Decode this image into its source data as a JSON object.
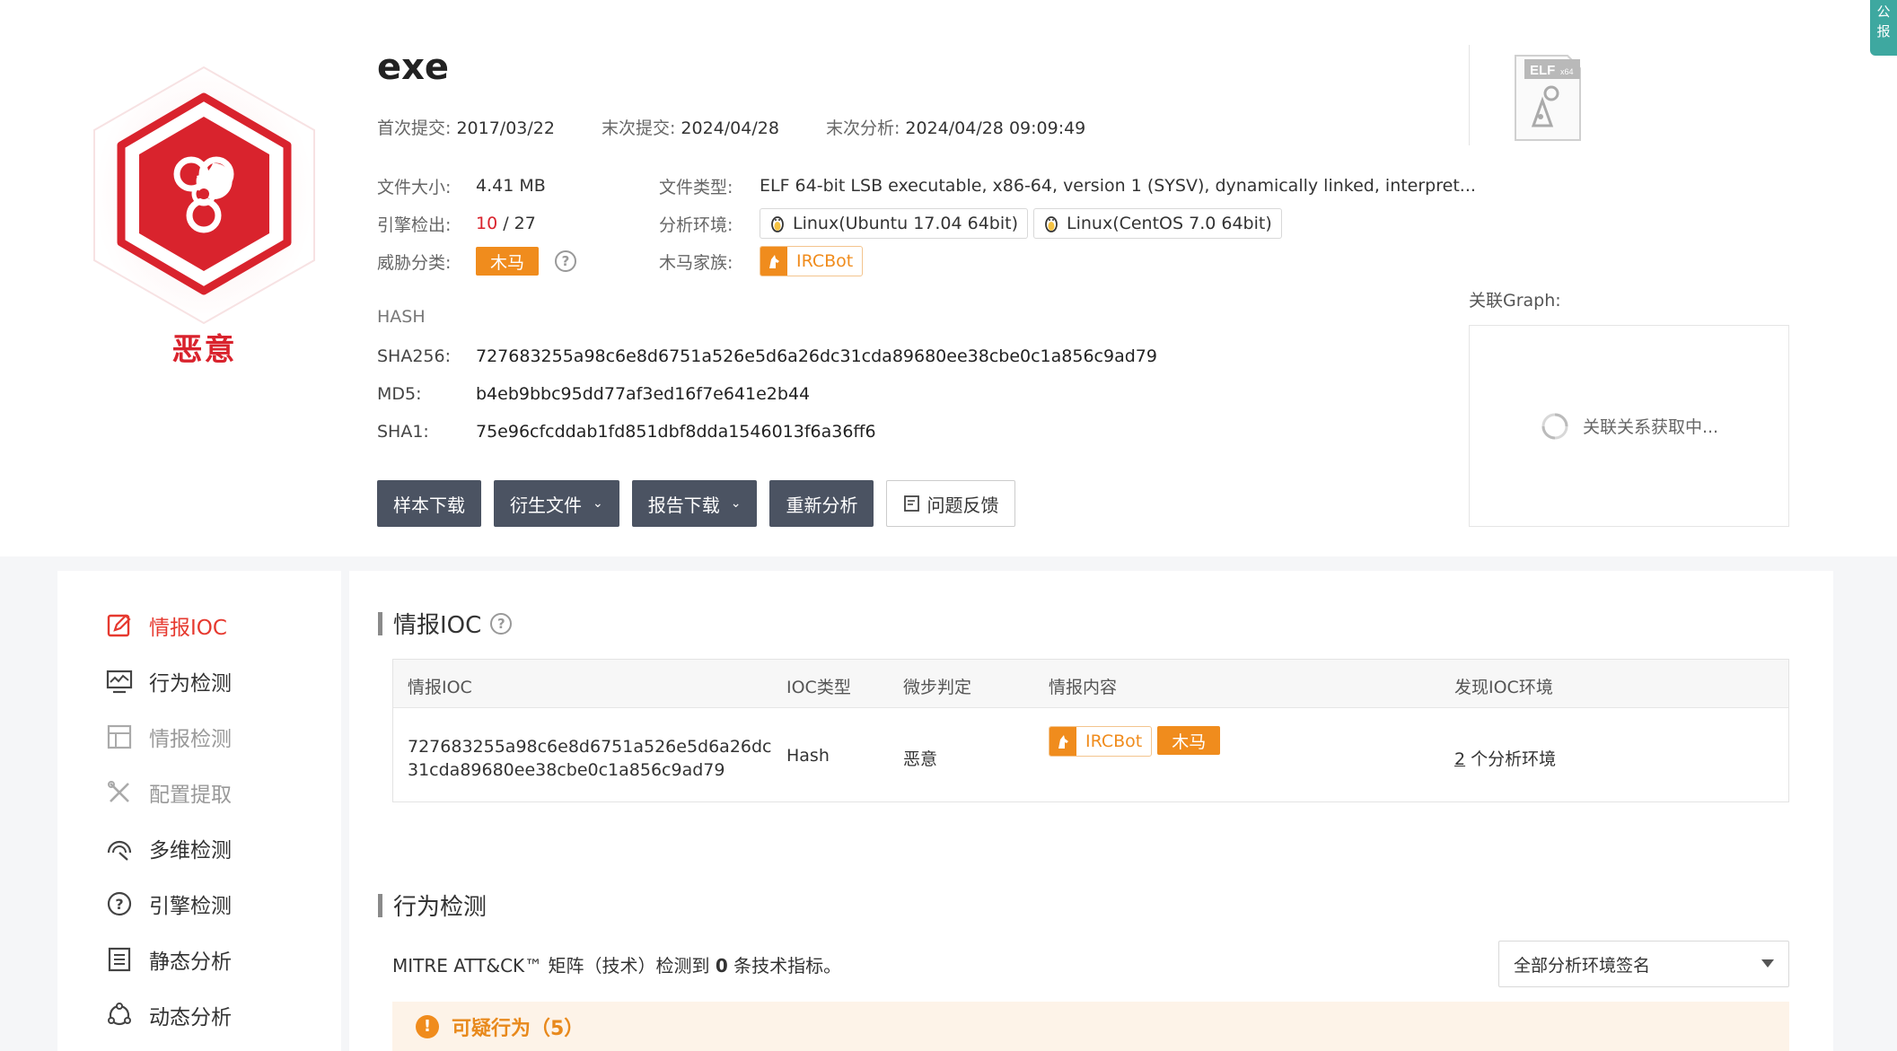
{
  "verdict": {
    "label": "恶意",
    "color": "#d9232d"
  },
  "file": {
    "name": "exe",
    "first_submit_label": "首次提交:",
    "first_submit": "2017/03/22",
    "last_submit_label": "末次提交:",
    "last_submit": "2024/04/28",
    "last_analysis_label": "末次分析:",
    "last_analysis": "2024/04/28 09:09:49",
    "size_label": "文件大小:",
    "size": "4.41 MB",
    "type_label": "文件类型:",
    "type": "ELF 64-bit LSB executable, x86-64, version 1 (SYSV), dynamically linked, interpret...",
    "engine_label": "引擎检出:",
    "engine_hits": "10",
    "engine_total": "/ 27",
    "env_label": "分析环境:",
    "envs": [
      "Linux(Ubuntu 17.04 64bit)",
      "Linux(CentOS 7.0 64bit)"
    ],
    "threat_label": "威胁分类:",
    "threat": "木马",
    "family_label": "木马家族:",
    "family": "IRCBot"
  },
  "hash": {
    "title": "HASH",
    "sha256_label": "SHA256:",
    "sha256": "727683255a98c6e8d6751a526e5d6a26dc31cda89680ee38cbe0c1a856c9ad79",
    "md5_label": "MD5:",
    "md5": "b4eb9bbc95dd77af3ed16f7e641e2b44",
    "sha1_label": "SHA1:",
    "sha1": "75e96cfcddab1fd851dbf8dda1546013f6a36ff6"
  },
  "actions": {
    "download_sample": "样本下载",
    "derived_files": "衍生文件",
    "report_download": "报告下载",
    "reanalyze": "重新分析",
    "feedback": "问题反馈"
  },
  "elf_badge": {
    "text": "ELF",
    "sub": "x64"
  },
  "graph": {
    "label": "关联Graph:",
    "loading": "关联关系获取中..."
  },
  "corner": {
    "line1": "公",
    "line2": "报"
  },
  "sidebar": {
    "items": [
      {
        "label": "情报IOC",
        "icon": "edit-icon"
      },
      {
        "label": "行为检测",
        "icon": "monitor-icon"
      },
      {
        "label": "情报检测",
        "icon": "layout-icon"
      },
      {
        "label": "配置提取",
        "icon": "tools-icon"
      },
      {
        "label": "多维检测",
        "icon": "radar-icon"
      },
      {
        "label": "引擎检测",
        "icon": "question-icon"
      },
      {
        "label": "静态分析",
        "icon": "list-icon"
      },
      {
        "label": "动态分析",
        "icon": "cycle-icon"
      }
    ]
  },
  "ioc": {
    "title": "情报IOC",
    "headers": [
      "情报IOC",
      "IOC类型",
      "微步判定",
      "情报内容",
      "发现IOC环境"
    ],
    "rows": [
      {
        "ioc_line1": "727683255a98c6e8d6751a526e5d6a26dc",
        "ioc_line2": "31cda89680ee38cbe0c1a856c9ad79",
        "type": "Hash",
        "verdict": "恶意",
        "family": "IRCBot",
        "threat": "木马",
        "env_count": "2",
        "env_suffix": "个分析环境"
      }
    ]
  },
  "behavior": {
    "title": "行为检测",
    "mitre_prefix": "MITRE ATT&CK™ 矩阵（技术）检测到",
    "mitre_count": "0",
    "mitre_suffix": "条技术指标。",
    "select_value": "全部分析环境签名",
    "suspicious": "可疑行为（5）"
  },
  "colors": {
    "accent_red": "#e6392f",
    "orange": "#f08c1d",
    "dark_button": "#4b5362"
  }
}
